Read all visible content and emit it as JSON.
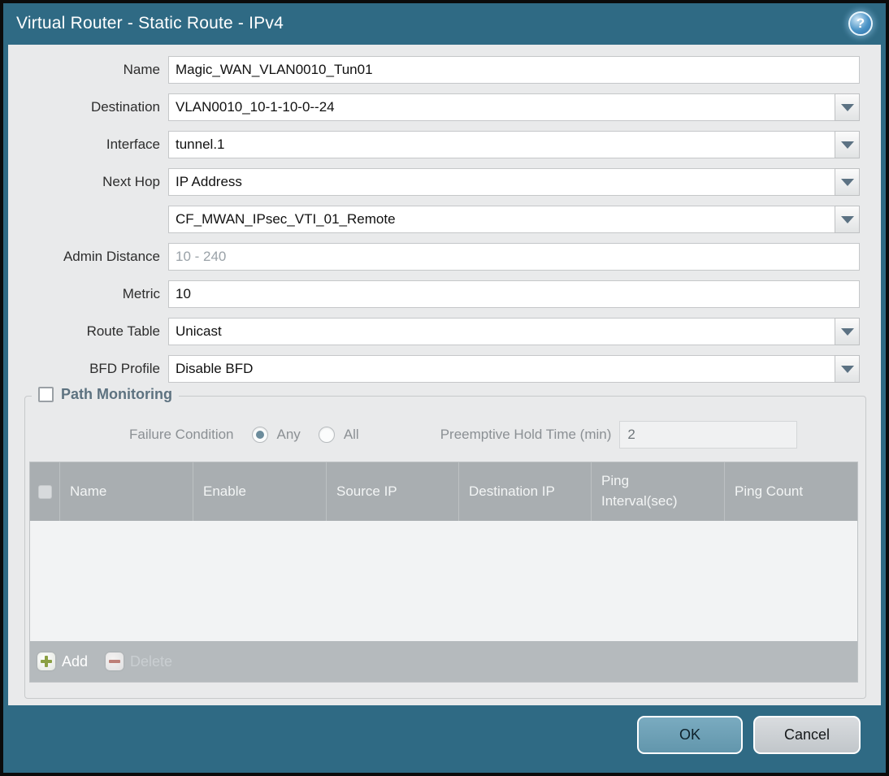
{
  "titlebar": {
    "title": "Virtual Router - Static Route - IPv4",
    "help_glyph": "?"
  },
  "form": {
    "name": {
      "label": "Name",
      "value": "Magic_WAN_VLAN0010_Tun01"
    },
    "destination": {
      "label": "Destination",
      "value": "VLAN0010_10-1-10-0--24"
    },
    "interface": {
      "label": "Interface",
      "value": "tunnel.1"
    },
    "next_hop": {
      "label": "Next Hop",
      "value": "IP Address"
    },
    "next_hop_address": {
      "value": "CF_MWAN_IPsec_VTI_01_Remote"
    },
    "admin_distance": {
      "label": "Admin Distance",
      "value": "",
      "placeholder": "10 - 240"
    },
    "metric": {
      "label": "Metric",
      "value": "10"
    },
    "route_table": {
      "label": "Route Table",
      "value": "Unicast"
    },
    "bfd_profile": {
      "label": "BFD Profile",
      "value": "Disable BFD"
    }
  },
  "path_monitoring": {
    "title": "Path Monitoring",
    "checked": false,
    "failure_condition": {
      "label": "Failure Condition",
      "options": [
        {
          "label": "Any",
          "selected": true
        },
        {
          "label": "All",
          "selected": false
        }
      ]
    },
    "preemptive_hold_time": {
      "label": "Preemptive Hold Time (min)",
      "value": "2"
    },
    "table": {
      "columns": [
        "Name",
        "Enable",
        "Source IP",
        "Destination IP",
        "Ping Interval(sec)",
        "Ping Count"
      ],
      "rows": []
    },
    "toolbar": {
      "add_label": "Add",
      "delete_label": "Delete"
    }
  },
  "footer": {
    "ok_label": "OK",
    "cancel_label": "Cancel"
  },
  "colors": {
    "frame_teal": "#2f6a84",
    "panel_bg": "#e9eaeb",
    "table_header_bg": "#a9aeb1",
    "table_footer_bg": "#b5babd",
    "ok_button": "#6ea2b8",
    "cancel_button": "#c9ced2",
    "add_icon_green": "#8ba043",
    "delete_icon_red": "#bd8078"
  }
}
